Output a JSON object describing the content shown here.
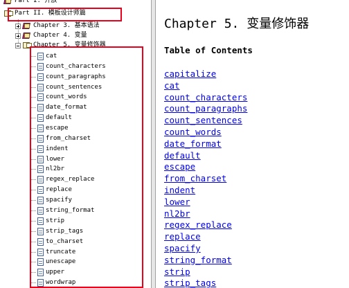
{
  "tree": {
    "parts": [
      {
        "label": "Part I. 开放",
        "expanded": false
      },
      {
        "label": "Part II. 模板设计师篇",
        "expanded": true
      }
    ],
    "chapters": [
      {
        "label": "Chapter 3. 基本语法",
        "expanded": false
      },
      {
        "label": "Chapter 4. 变量",
        "expanded": false
      },
      {
        "label": "Chapter 5. 变量修饰器",
        "expanded": true
      }
    ],
    "modifiers": [
      "cat",
      "count_characters",
      "count_paragraphs",
      "count_sentences",
      "count_words",
      "date_format",
      "default",
      "escape",
      "from_charset",
      "indent",
      "lower",
      "nl2br",
      "regex_replace",
      "replace",
      "spacify",
      "string_format",
      "strip",
      "strip_tags",
      "to_charset",
      "truncate",
      "unescape",
      "upper",
      "wordwrap"
    ]
  },
  "content": {
    "title": "Chapter 5. 变量修饰器",
    "toc_heading": "Table of Contents",
    "links": [
      "capitalize",
      "cat",
      "count_characters",
      "count_paragraphs",
      "count_sentences",
      "count_words",
      "date_format",
      "default",
      "escape",
      "from_charset",
      "indent",
      "lower",
      "nl2br",
      "regex_replace",
      "replace",
      "spacify",
      "string_format",
      "strip",
      "strip_tags"
    ]
  },
  "colors": {
    "highlight": "#e8001c",
    "link": "#0000ee",
    "book": "#b4306e"
  }
}
